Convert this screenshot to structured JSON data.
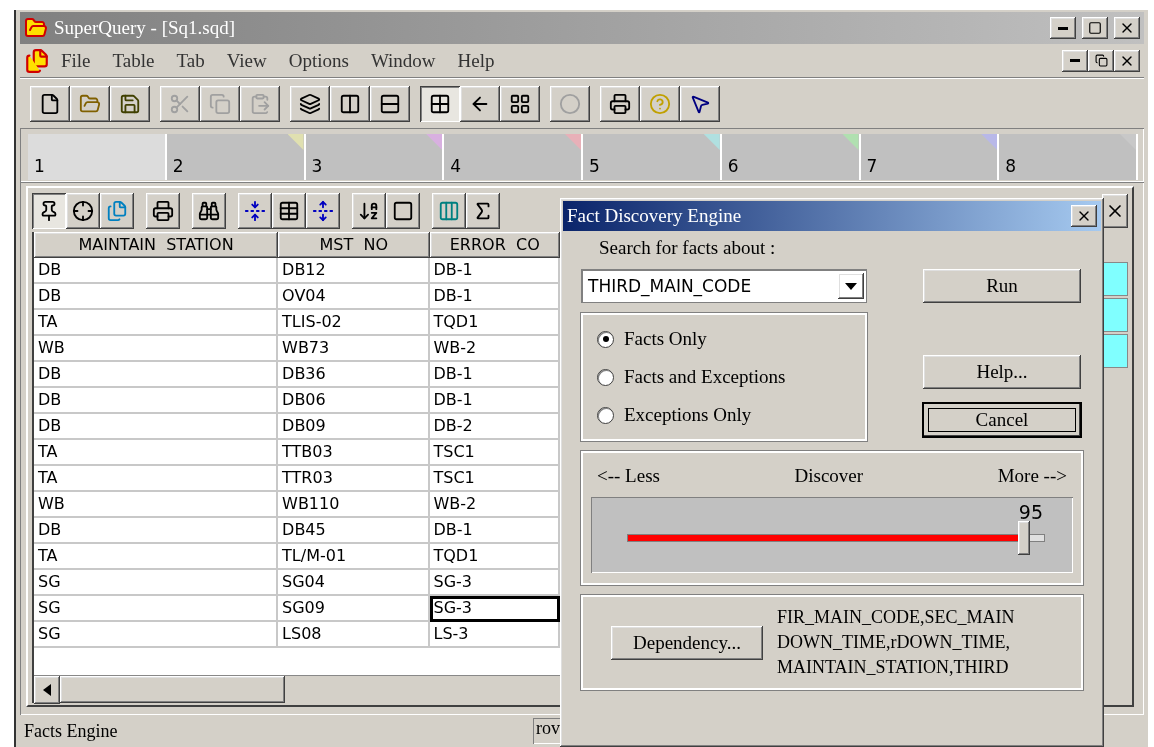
{
  "window": {
    "title": "SuperQuery - [Sq1.sqd]"
  },
  "menu": [
    "File",
    "Table",
    "Tab",
    "View",
    "Options",
    "Window",
    "Help"
  ],
  "toolbar": [
    [
      {
        "kind": "new",
        "pressed": false,
        "disabled": false
      },
      {
        "kind": "open",
        "pressed": false,
        "disabled": false
      },
      {
        "kind": "save",
        "pressed": false,
        "disabled": false
      }
    ],
    [
      {
        "kind": "cut",
        "pressed": false,
        "disabled": true
      },
      {
        "kind": "copy",
        "pressed": false,
        "disabled": true
      },
      {
        "kind": "paste",
        "pressed": false,
        "disabled": true
      }
    ],
    [
      {
        "kind": "cascade",
        "pressed": false,
        "disabled": false
      },
      {
        "kind": "tile-vertical",
        "pressed": false,
        "disabled": false
      },
      {
        "kind": "tile-horizontal",
        "pressed": false,
        "disabled": false
      }
    ],
    [
      {
        "kind": "grid",
        "pressed": true,
        "disabled": false
      },
      {
        "kind": "back",
        "pressed": false,
        "disabled": false
      },
      {
        "kind": "layout",
        "pressed": false,
        "disabled": false
      }
    ],
    [
      {
        "kind": "engine",
        "pressed": false,
        "disabled": true
      }
    ],
    [
      {
        "kind": "print",
        "pressed": false,
        "disabled": false
      },
      {
        "kind": "help",
        "pressed": false,
        "disabled": false
      },
      {
        "kind": "context-help",
        "pressed": false,
        "disabled": false
      }
    ]
  ],
  "tabs": [
    {
      "label": "1",
      "selected": true
    },
    {
      "label": "2",
      "selected": false,
      "color": "#e0e0b0"
    },
    {
      "label": "3",
      "selected": false,
      "color": "#d8b0e0"
    },
    {
      "label": "4",
      "selected": false,
      "color": "#e8b0b8"
    },
    {
      "label": "5",
      "selected": false,
      "color": "#b0e0e0"
    },
    {
      "label": "6",
      "selected": false,
      "color": "#b0e0b0"
    },
    {
      "label": "7",
      "selected": false,
      "color": "#b8b8e8"
    },
    {
      "label": "8",
      "selected": false,
      "color": "#c8c8c8"
    }
  ],
  "grid_toolbar": [
    [
      {
        "kind": "pin",
        "pressed": true
      },
      {
        "kind": "target",
        "pressed": false
      },
      {
        "kind": "duplicate",
        "pressed": false
      }
    ],
    [
      {
        "kind": "print",
        "pressed": false
      }
    ],
    [
      {
        "kind": "find",
        "pressed": false
      }
    ],
    [
      {
        "kind": "collapse",
        "pressed": false
      },
      {
        "kind": "table",
        "pressed": false
      },
      {
        "kind": "expand",
        "pressed": false
      }
    ],
    [
      {
        "kind": "sort",
        "pressed": false
      },
      {
        "kind": "square",
        "pressed": false
      }
    ],
    [
      {
        "kind": "column",
        "pressed": false
      },
      {
        "kind": "sum",
        "pressed": false
      }
    ]
  ],
  "table": {
    "columns": [
      "MAINTAIN  STATION",
      "MST  NO",
      "ERROR  CO"
    ],
    "rows": [
      {
        "cells": [
          "DB",
          "DB12",
          "DB-1"
        ],
        "selected": false
      },
      {
        "cells": [
          "DB",
          "OV04",
          "DB-1"
        ],
        "selected": false
      },
      {
        "cells": [
          "TA",
          "TLIS-02",
          "TQD1"
        ],
        "selected": false
      },
      {
        "cells": [
          "WB",
          "WB73",
          "WB-2"
        ],
        "selected": false
      },
      {
        "cells": [
          "DB",
          "DB36",
          "DB-1"
        ],
        "selected": false
      },
      {
        "cells": [
          "DB",
          "DB06",
          "DB-1"
        ],
        "selected": false
      },
      {
        "cells": [
          "DB",
          "DB09",
          "DB-2"
        ],
        "selected": false
      },
      {
        "cells": [
          "TA",
          "TTB03",
          "TSC1"
        ],
        "selected": false
      },
      {
        "cells": [
          "TA",
          "TTR03",
          "TSC1"
        ],
        "selected": false
      },
      {
        "cells": [
          "WB",
          "WB110",
          "WB-2"
        ],
        "selected": false
      },
      {
        "cells": [
          "DB",
          "DB45",
          "DB-1"
        ],
        "selected": false
      },
      {
        "cells": [
          "TA",
          "TL/M-01",
          "TQD1"
        ],
        "selected": false
      },
      {
        "cells": [
          "SG",
          "SG04",
          "SG-3"
        ],
        "selected": false
      },
      {
        "cells": [
          "SG",
          "SG09",
          "SG-3"
        ],
        "selected": true
      },
      {
        "cells": [
          "SG",
          "LS08",
          "LS-3"
        ],
        "selected": false
      }
    ]
  },
  "status_bar": [
    "Facts Engine",
    "rov"
  ],
  "dialog": {
    "title": "Fact Discovery Engine",
    "search_label": "Search for facts about :",
    "field": "THIRD_MAIN_CODE",
    "buttons": [
      {
        "label": "Run",
        "default": false
      },
      {
        "label": "Help...",
        "default": false
      },
      {
        "label": "Cancel",
        "default": true
      }
    ],
    "options": [
      {
        "label": "Facts Only",
        "selected": true
      },
      {
        "label": "Facts and Exceptions",
        "selected": false
      },
      {
        "label": "Exceptions Only",
        "selected": false
      }
    ],
    "slider": {
      "less": "<-- Less",
      "center": "Discover",
      "more": "More -->",
      "value": "95",
      "level": 0.95
    },
    "dependency": {
      "button": "Dependency...",
      "fields": [
        "FIR_MAIN_CODE,SEC_MAIN",
        "DOWN_TIME,rDOWN_TIME,",
        "MAINTAIN_STATION,THIRD"
      ]
    }
  }
}
